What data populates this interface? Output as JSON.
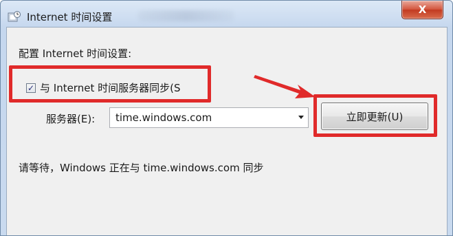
{
  "window": {
    "title": "Internet 时间设置",
    "close_label": "X"
  },
  "dialog": {
    "heading": "配置 Internet 时间设置:",
    "sync_checkbox": {
      "label": "与 Internet 时间服务器同步(S",
      "checked": true
    },
    "server": {
      "label": "服务器(E):",
      "value": "time.windows.com"
    },
    "update_button": "立即更新(U)",
    "status": "请等待，Windows 正在与 time.windows.com 同步"
  },
  "annotation": {
    "highlight_color": "#e02a2a"
  },
  "icons": [
    "clock-settings-icon",
    "close-icon",
    "checkmark-icon",
    "dropdown-arrow-icon",
    "pointer-arrow"
  ]
}
